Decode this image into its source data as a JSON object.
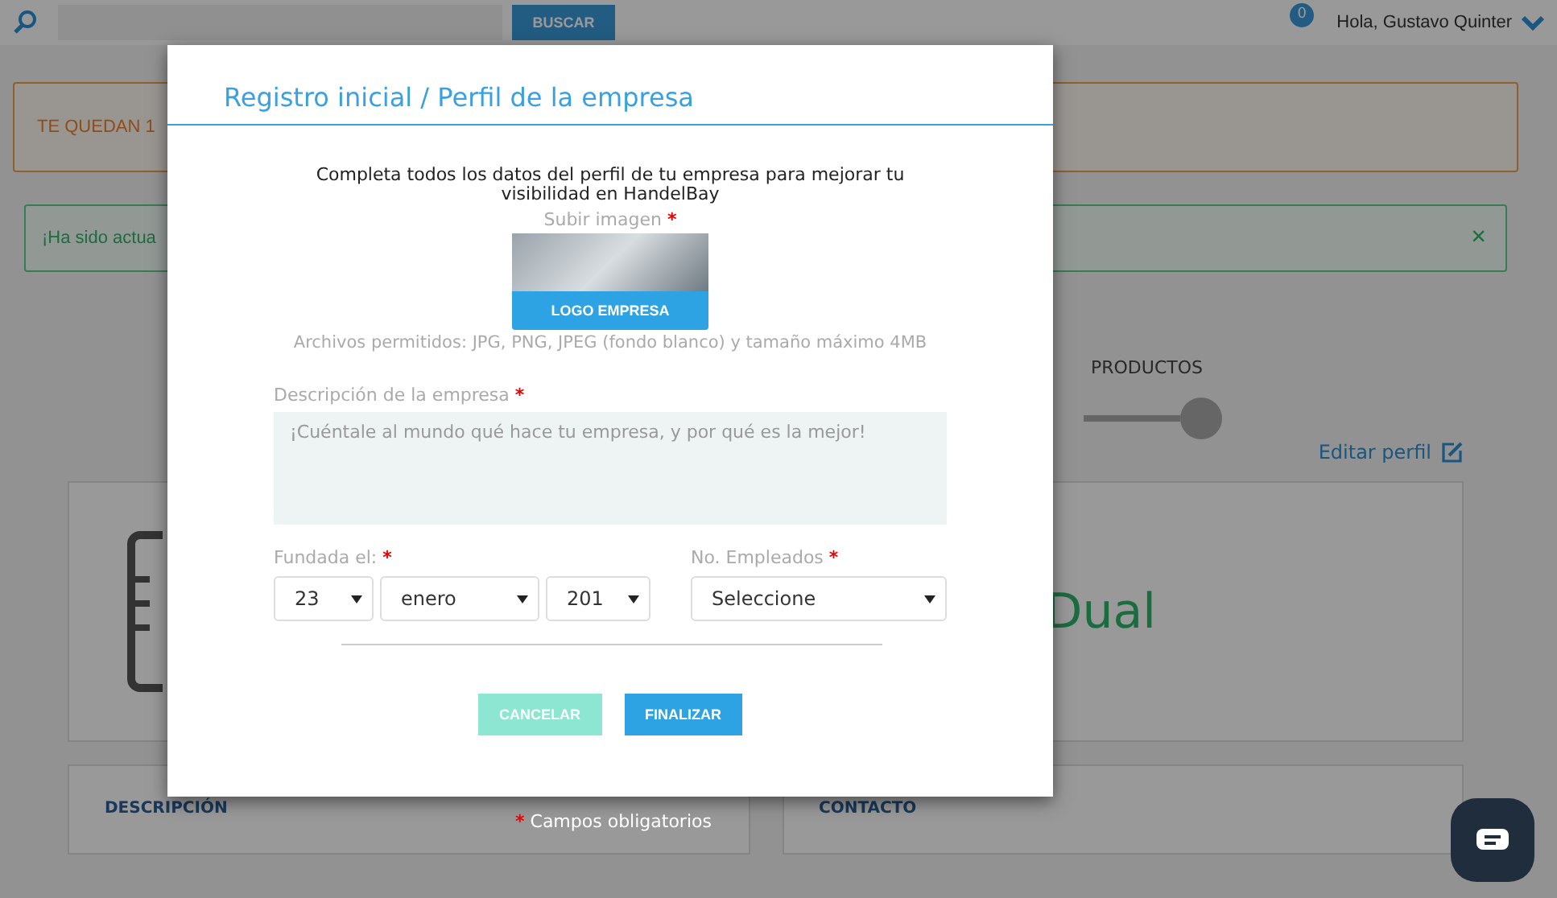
{
  "topbar": {
    "search_button": "BUSCAR",
    "notification_count": "0",
    "greeting": "Hola, Gustavo Quinter"
  },
  "alerts": [
    {
      "kind": "warning",
      "text": "TE QUEDAN 1"
    },
    {
      "kind": "success",
      "text": "¡Ha sido actua",
      "close": "×"
    }
  ],
  "steps": [
    {
      "label": "PRODUCTOS"
    }
  ],
  "edit_profile": "Editar perfil",
  "profile_card": {
    "text": "Dual"
  },
  "sections": [
    {
      "title": "DESCRIPCIÓN"
    },
    {
      "title": "CONTACTO"
    }
  ],
  "modal": {
    "title": "Registro inicial / Perfil de la empresa",
    "intro": "Completa todos los datos del perfil de tu empresa para mejorar tu visibilidad en HandelBay",
    "image_label": "Subir imagen",
    "required_mark": "*",
    "logo_button": "LOGO EMPRESA",
    "file_hint": "Archivos permitidos: JPG, PNG, JPEG (fondo blanco) y tamaño máximo 4MB",
    "description_label": "Descripción de la empresa",
    "description_placeholder": "¡Cuéntale al mundo qué hace tu empresa, y por qué es la mejor!",
    "founded_label": "Fundada el:",
    "founded": [
      "23",
      "enero",
      "201"
    ],
    "employees_label": "No. Empleados",
    "employees": "Seleccione",
    "buttons": [
      {
        "label": "CANCELAR",
        "kind": "secondary"
      },
      {
        "label": "FINALIZAR",
        "kind": "primary"
      }
    ]
  },
  "required_note": {
    "mark": "*",
    "text": "Campos obligatorios"
  }
}
